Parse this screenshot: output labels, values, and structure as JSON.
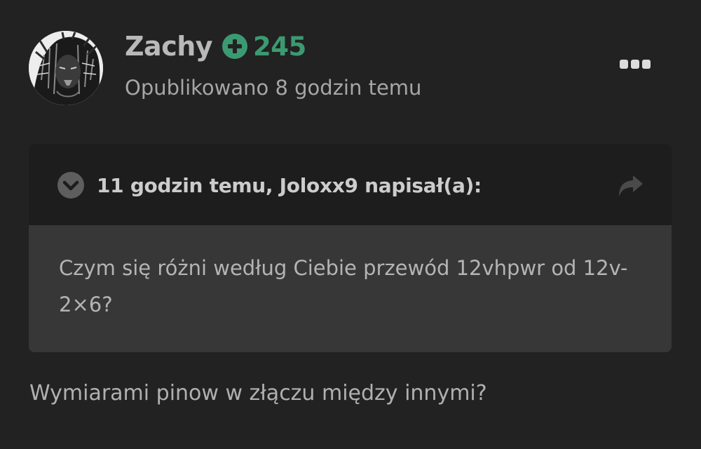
{
  "post": {
    "avatar_icon": "user-avatar",
    "author": {
      "name": "Zachy",
      "reputation_icon": "plus-circle-icon",
      "reputation": "245",
      "reputation_color": "#3b9a72"
    },
    "published": "Opublikowano 8 godzin temu",
    "menu_icon": "more-options-icon"
  },
  "quote": {
    "toggle_icon": "chevron-down-circle-icon",
    "citation": "11 godzin temu, Joloxx9 napisał(a):",
    "share_icon": "share-icon",
    "text": "Czym się różni według Ciebie przewód 12vhpwr od 12v-2×6?"
  },
  "reply": {
    "text": "Wymiarami pinow w złączu między innymi?"
  },
  "colors": {
    "background": "#222222",
    "quote_header": "#1d1d1d",
    "quote_body": "#373737",
    "accent_green": "#3b9a72"
  }
}
